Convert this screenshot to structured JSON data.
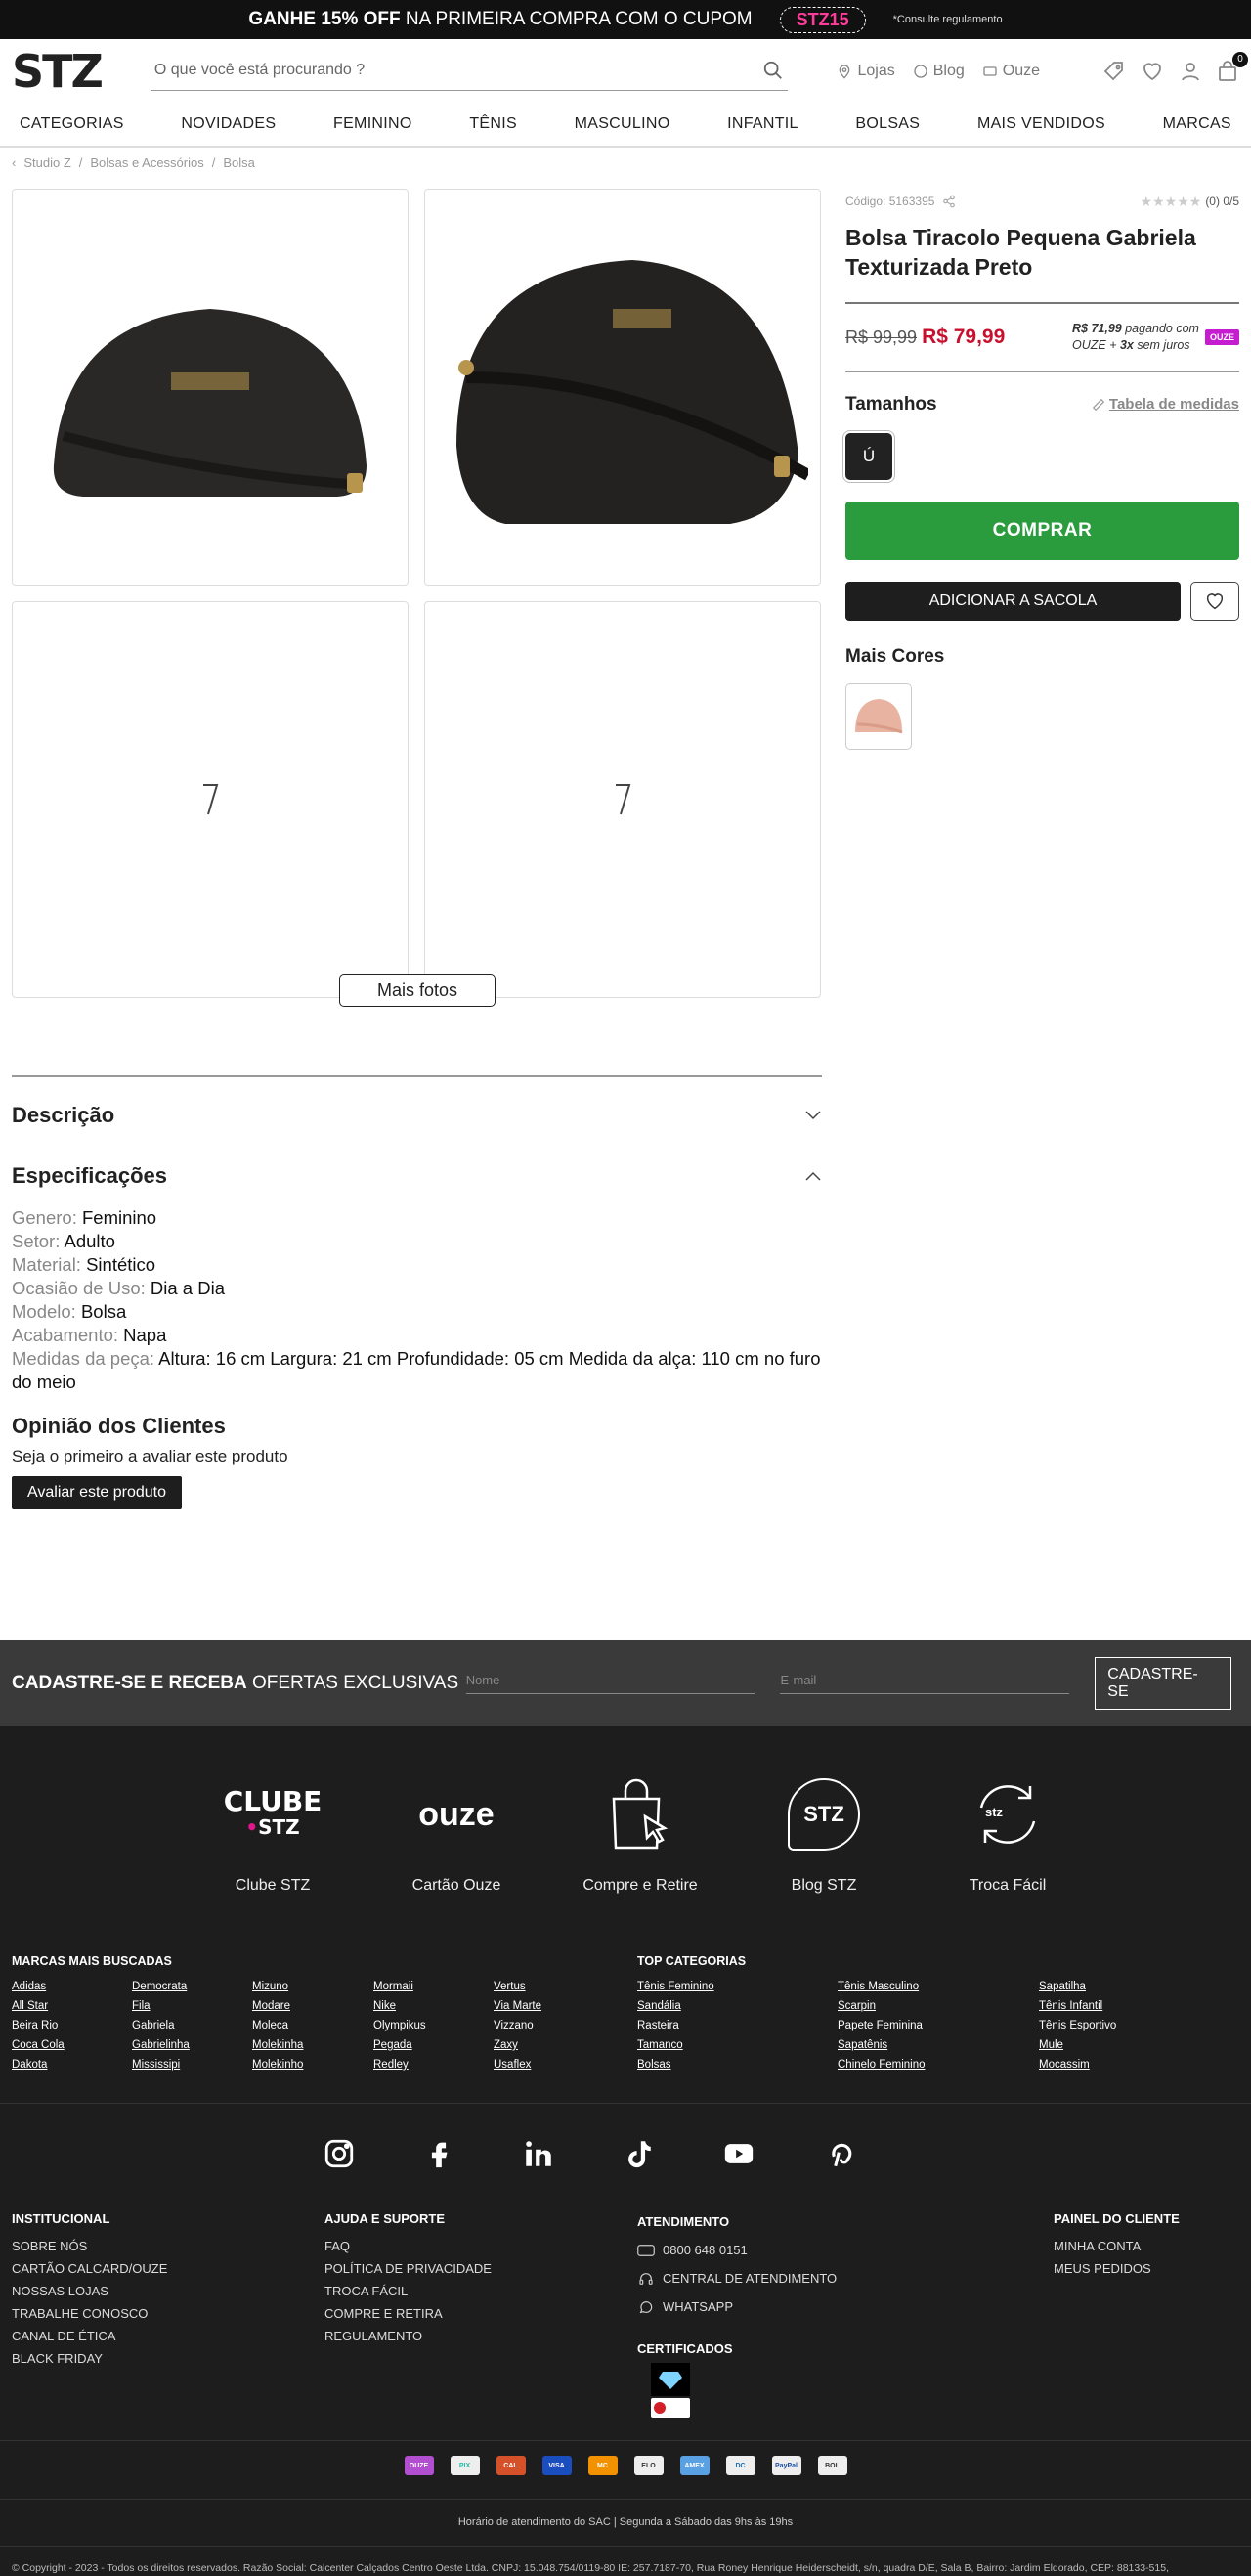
{
  "topbar": {
    "promo_bold": "GANHE 15% OFF",
    "promo_rest": "NA PRIMEIRA COMPRA COM O CUPOM",
    "coupon": "STZ15",
    "note": "*Consulte regulamento"
  },
  "header": {
    "logo": "STZ",
    "search_placeholder": "O que você está procurando ?",
    "links": [
      "Lojas",
      "Blog",
      "Ouze"
    ],
    "cart_count": "0"
  },
  "nav": [
    "CATEGORIAS",
    "NOVIDADES",
    "FEMININO",
    "TÊNIS",
    "MASCULINO",
    "INFANTIL",
    "BOLSAS",
    "MAIS VENDIDOS",
    "MARCAS"
  ],
  "breadcrumb": [
    "Studio Z",
    "Bolsas e Acessórios",
    "Bolsa"
  ],
  "gallery": {
    "more_photos": "Mais fotos"
  },
  "product": {
    "code": "Código: 5163395",
    "rating": "(0) 0/5",
    "title": "Bolsa Tiracolo Pequena Gabriela Texturizada Preto",
    "old_price": "R$ 99,99",
    "price": "R$ 79,99",
    "ouze_price": "R$ 71,99",
    "ouze_line1": "pagando com",
    "ouze_line2a": "OUZE + ",
    "ouze_line2b": "3x",
    "ouze_line2c": " sem juros",
    "ouze_tag": "OUZE",
    "sizes_title": "Tamanhos",
    "size_chart": "Tabela de medidas",
    "size": "Ú",
    "buy": "COMPRAR",
    "add_bag": "ADICIONAR A SACOLA",
    "more_colors": "Mais Cores"
  },
  "description": {
    "title": "Descrição"
  },
  "specs": {
    "title": "Especificações",
    "items": [
      {
        "k": "Genero:",
        "v": "Feminino"
      },
      {
        "k": "Setor:",
        "v": "Adulto"
      },
      {
        "k": "Material:",
        "v": "Sintético"
      },
      {
        "k": "Ocasião de Uso:",
        "v": "Dia a Dia"
      },
      {
        "k": "Modelo:",
        "v": "Bolsa"
      },
      {
        "k": "Acabamento:",
        "v": "Napa"
      },
      {
        "k": "Medidas da peça:",
        "v": "Altura: 16 cm Largura: 21 cm Profundidade: 05 cm Medida da alça: 110 cm no furo do meio"
      }
    ]
  },
  "reviews": {
    "title": "Opinião dos Clientes",
    "empty": "Seja o primeiro a avaliar este produto",
    "button": "Avaliar este produto"
  },
  "newsletter": {
    "title_bold": "CADASTRE-SE E RECEBA",
    "title_rest": "OFERTAS EXCLUSIVAS",
    "name_placeholder": "Nome",
    "email_placeholder": "E-mail",
    "button": "CADASTRE-SE"
  },
  "features": [
    "Clube STZ",
    "Cartão Ouze",
    "Compre e Retire",
    "Blog STZ",
    "Troca Fácil"
  ],
  "feature_logos": {
    "clube1": "CLUBE",
    "clube2": "STZ",
    "ouze": "ouze",
    "blog": "STZ",
    "troca": "stz"
  },
  "brands": {
    "title": "MARCAS MAIS BUSCADAS",
    "cols": [
      [
        "Adidas",
        "All Star",
        "Beira Rio",
        "Coca Cola",
        "Dakota"
      ],
      [
        "Democrata",
        "Fila",
        "Gabriela",
        "Gabrielinha",
        "Mississipi"
      ],
      [
        "Mizuno",
        "Modare",
        "Moleca",
        "Molekinha",
        "Molekinho"
      ],
      [
        "Mormaii",
        "Nike",
        "Olympikus",
        "Pegada",
        "Redley"
      ],
      [
        "Vertus",
        "Via Marte",
        "Vizzano",
        "Zaxy",
        "Usaflex"
      ]
    ]
  },
  "categories": {
    "title": "TOP CATEGORIAS",
    "cols": [
      [
        "Tênis Feminino",
        "Sandália",
        "Rasteira",
        "Tamanco",
        "Bolsas"
      ],
      [
        "Tênis Masculino",
        "Scarpin",
        "Papete Feminina",
        "Sapatênis",
        "Chinelo Feminino"
      ],
      [
        "Sapatilha",
        "Tênis Infantil",
        "Tênis Esportivo",
        "Mule",
        "Mocassim"
      ]
    ]
  },
  "institucional": {
    "title": "INSTITUCIONAL",
    "items": [
      "SOBRE NÓS",
      "CARTÃO CALCARD/OUZE",
      "NOSSAS LOJAS",
      "TRABALHE CONOSCO",
      "CANAL DE ÉTICA",
      "BLACK FRIDAY"
    ]
  },
  "ajuda": {
    "title": "AJUDA E SUPORTE",
    "items": [
      "FAQ",
      "POLÍTICA DE PRIVACIDADE",
      "TROCA FÁCIL",
      "COMPRE E RETIRA",
      "REGULAMENTO"
    ]
  },
  "atendimento": {
    "title": "ATENDIMENTO",
    "phone": "0800 648 0151",
    "central": "CENTRAL DE ATENDIMENTO",
    "whatsapp": "WHATSAPP",
    "cert_title": "CERTIFICADOS"
  },
  "painel": {
    "title": "PAINEL DO CLIENTE",
    "items": [
      "MINHA CONTA",
      "MEUS PEDIDOS"
    ]
  },
  "payments": [
    "OUZE",
    "PIX",
    "CAL",
    "VISA",
    "MC",
    "ELO",
    "AMEX",
    "DC",
    "PayPal",
    "BOL"
  ],
  "hours": "Horário de atendimento do SAC | Segunda a Sábado das 9hs às 19hs",
  "copyright": "© Copyright - 2023 - Todos os direitos reservados. Razão Social: Calcenter Calçados Centro Oeste Ltda. CNPJ: 15.048.754/0119-80 IE: 257.7187-70, Rua Roney Henrique Heiderscheidt, s/n, quadra D/E, Sala B, Bairro: Jardim Eldorado, CEP: 88133-515,"
}
